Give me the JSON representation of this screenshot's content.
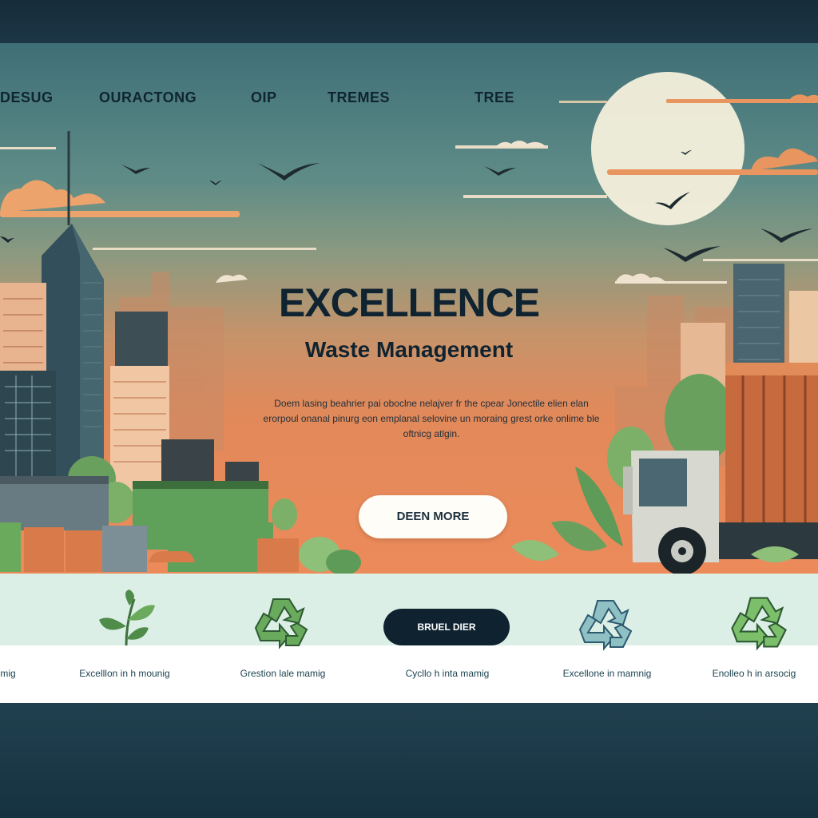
{
  "nav": {
    "items": [
      {
        "label": "DESUG"
      },
      {
        "label": "OURACTONG"
      },
      {
        "label": "OIP"
      },
      {
        "label": "TREMES"
      },
      {
        "label": "TREE"
      }
    ]
  },
  "hero": {
    "headline": "EXCELLENCE",
    "subheadline": "Waste Management",
    "description": "Doem lasing beahrier pai oboclne nelajver fr the cpear Jonectile elien elan erorpoul onanal pinurg eon emplanal selovine un moraing grest orke onlime ble oftnicg atlgin.",
    "cta_label": "DEEN MORE"
  },
  "features": {
    "button_label": "BRUEL DIER",
    "items": [
      {
        "label": "mig",
        "icon": "leaf-icon"
      },
      {
        "label": "Excelllon in h mounig",
        "icon": "leaf-icon"
      },
      {
        "label": "Grestion lale mamig",
        "icon": "recycle-icon"
      },
      {
        "label": "Cycllo h inta mamig",
        "icon": "recycle-icon"
      },
      {
        "label": "Excellone in mamnig",
        "icon": "recycle-icon"
      },
      {
        "label": "Enolleo h in arsocig",
        "icon": "recycle-icon"
      }
    ]
  },
  "colors": {
    "sky_top": "#3f6f77",
    "sky_bottom": "#ec8a5a",
    "feature_band": "#dcefe6",
    "dark_button": "#0f2230",
    "icon_green": "#5f9a4f"
  }
}
